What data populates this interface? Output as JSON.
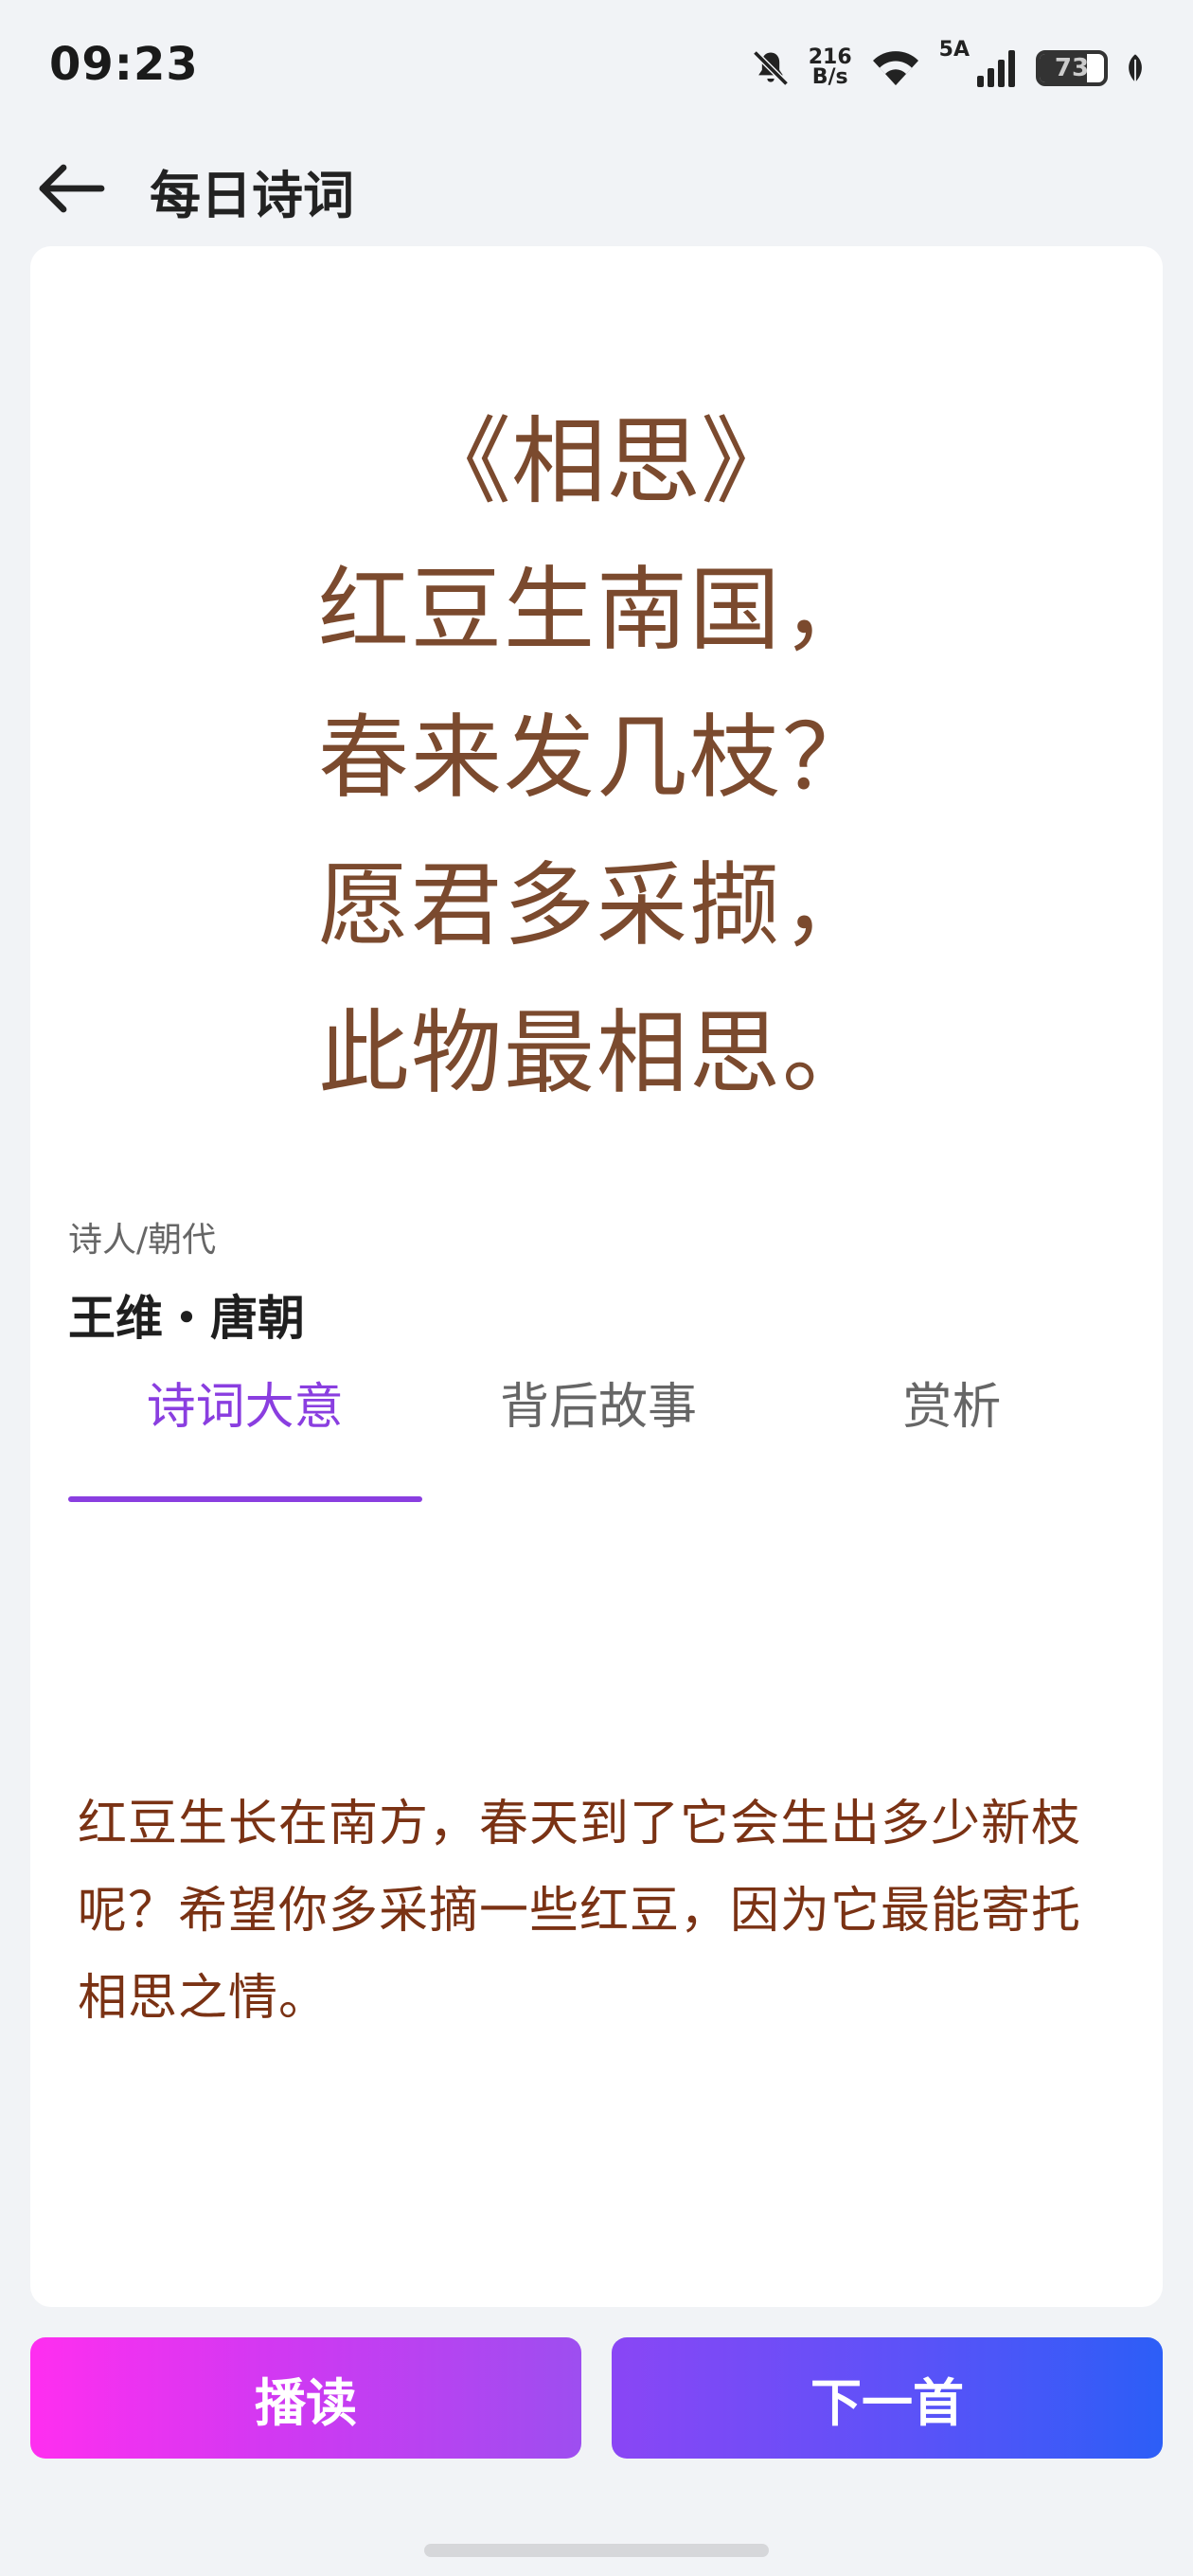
{
  "status_bar": {
    "time": "09:23",
    "net_speed_value": "216",
    "net_speed_unit": "B/s",
    "network_label": "5A",
    "battery_level": "73",
    "icons": [
      "bell-muted-icon",
      "wifi-icon",
      "signal-icon",
      "battery-icon",
      "leaf-icon"
    ]
  },
  "header": {
    "title": "每日诗词"
  },
  "poem": {
    "title": "《相思》",
    "lines": [
      "红豆生南国，",
      "春来发几枝？",
      "愿君多采撷，",
      "此物最相思。"
    ],
    "color": "#7b4a2e"
  },
  "author": {
    "label": "诗人/朝代",
    "value": "王维・唐朝"
  },
  "tabs": [
    {
      "label": "诗词大意",
      "active": true
    },
    {
      "label": "背后故事",
      "active": false
    },
    {
      "label": "赏析",
      "active": false
    }
  ],
  "tab_content": {
    "text": "红豆生长在南方，春天到了它会生出多少新枝呢？希望你多采摘一些红豆，因为它最能寄托相思之情。"
  },
  "buttons": {
    "read_label": "播读",
    "next_label": "下一首"
  },
  "colors": {
    "accent": "#8a3ee0",
    "content_text": "#7a3214",
    "background": "#f1f3f6"
  }
}
